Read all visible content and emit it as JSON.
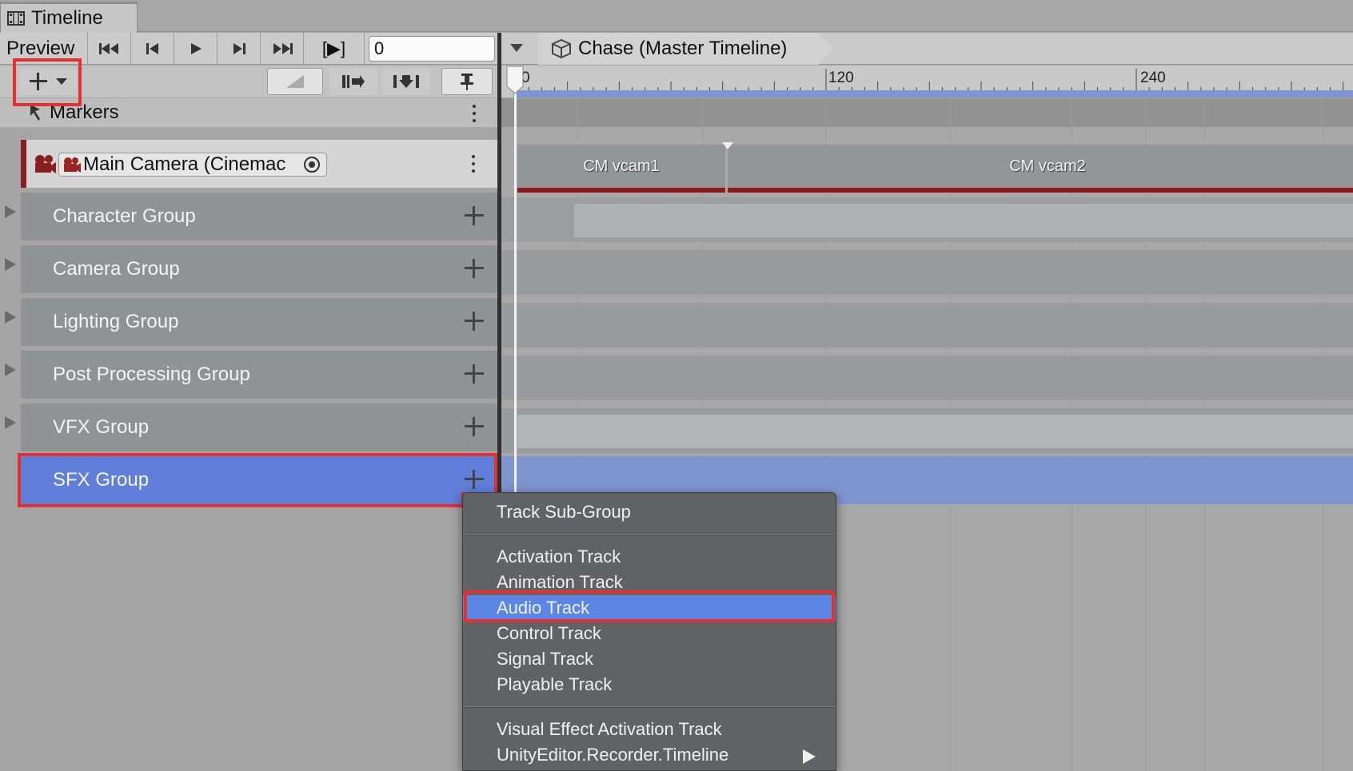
{
  "window": {
    "tab_title": "Timeline"
  },
  "toolbar": {
    "preview_label": "Preview",
    "frame_value": "0",
    "play_range_label": "[▶]"
  },
  "breadcrumb": {
    "title": "Chase (Master Timeline)"
  },
  "ruler": {
    "labels": [
      "0",
      "120",
      "240"
    ]
  },
  "tracks": {
    "markers_label": "Markers",
    "camera_label": "Main Camera (Cinemac",
    "groups": [
      "Character Group",
      "Camera Group",
      "Lighting Group",
      "Post Processing Group",
      "VFX Group",
      "SFX Group"
    ]
  },
  "clips": [
    "CM vcam1",
    "CM vcam2"
  ],
  "menu": {
    "items": [
      "Track Sub-Group",
      "Activation Track",
      "Animation Track",
      "Audio Track",
      "Control Track",
      "Signal Track",
      "Playable Track",
      "Visual Effect Activation Track",
      "UnityEditor.Recorder.Timeline"
    ],
    "selected": "Audio Track"
  },
  "colors": {
    "selection": "#5f7fda",
    "highlight": "#e33030",
    "camera_track": "#8a1e1e"
  }
}
